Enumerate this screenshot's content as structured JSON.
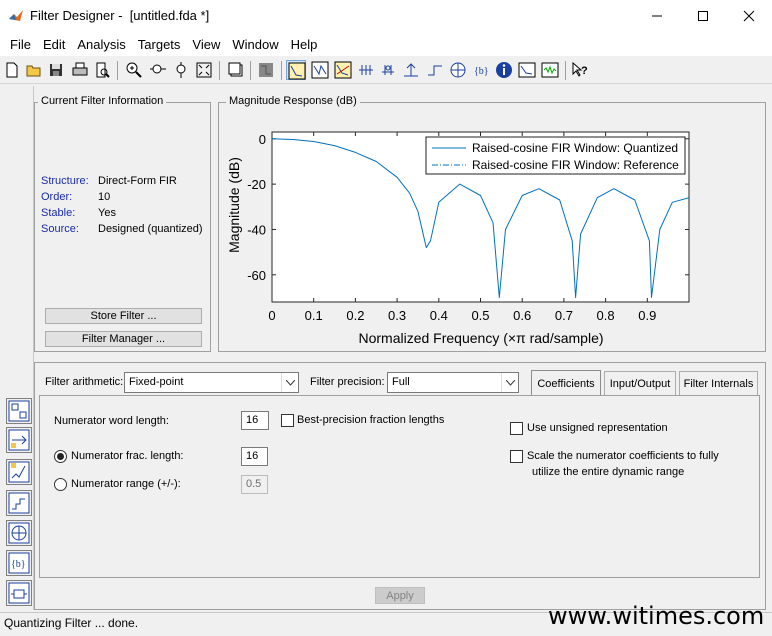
{
  "window": {
    "title": "Filter Designer -  [untitled.fda *]"
  },
  "menu": [
    "File",
    "Edit",
    "Analysis",
    "Targets",
    "View",
    "Window",
    "Help"
  ],
  "toolbar": {
    "icons": [
      "new-icon",
      "open-icon",
      "save-icon",
      "print-icon",
      "print-preview-icon",
      "zoom-in-icon",
      "zoom-x-icon",
      "zoom-y-icon",
      "full-view-icon",
      "new-figure-icon",
      "filter-specs-icon",
      "magnitude-response-icon",
      "phase-response-icon",
      "magnitude-phase-icon",
      "group-delay-icon",
      "phase-delay-icon",
      "impulse-response-icon",
      "step-response-icon",
      "pole-zero-icon",
      "filter-coefficients-icon",
      "filter-info-icon",
      "magnitude-estimate-icon",
      "round-off-noise-icon",
      "whats-this-icon"
    ]
  },
  "current_filter": {
    "title": "Current Filter Information",
    "rows": [
      {
        "label": "Structure:",
        "value": "Direct-Form FIR"
      },
      {
        "label": "Order:",
        "value": "10"
      },
      {
        "label": "Stable:",
        "value": "Yes"
      },
      {
        "label": "Source:",
        "value": "Designed (quantized)"
      }
    ],
    "store_button": "Store Filter ...",
    "manager_button": "Filter Manager ..."
  },
  "plot": {
    "title": "Magnitude Response (dB)",
    "chart_data": {
      "type": "line",
      "xlabel": "Normalized Frequency (×π rad/sample)",
      "ylabel": "Magnitude (dB)",
      "xlim": [
        0,
        1
      ],
      "ylim": [
        -72,
        3
      ],
      "xticks": [
        "0",
        "0.1",
        "0.2",
        "0.3",
        "0.4",
        "0.5",
        "0.6",
        "0.7",
        "0.8",
        "0.9"
      ],
      "yticks": [
        "0",
        "-20",
        "-40",
        "-60"
      ],
      "legend": [
        "Raised-cosine FIR Window: Quantized",
        "Raised-cosine FIR Window: Reference"
      ],
      "legend_position": "top-right",
      "series": [
        {
          "name": "Raised-cosine FIR Window: Quantized",
          "x": [
            0,
            0.05,
            0.1,
            0.15,
            0.2,
            0.25,
            0.3,
            0.33,
            0.35,
            0.37,
            0.38,
            0.4,
            0.45,
            0.5,
            0.53,
            0.545,
            0.56,
            0.6,
            0.64,
            0.69,
            0.72,
            0.728,
            0.74,
            0.78,
            0.82,
            0.87,
            0.905,
            0.91,
            0.93,
            0.96,
            1.0
          ],
          "y": [
            0,
            -0.3,
            -1.2,
            -3,
            -6,
            -10,
            -17,
            -24,
            -32,
            -48,
            -45,
            -28,
            -20,
            -25,
            -37,
            -70,
            -40,
            -25,
            -22,
            -27,
            -45,
            -70,
            -42,
            -26,
            -22,
            -27,
            -45,
            -70,
            -40,
            -28,
            -26
          ]
        }
      ]
    }
  },
  "tabs": [
    "Coefficients",
    "Input/Output",
    "Filter Internals"
  ],
  "quant": {
    "arith_label": "Filter arithmetic:",
    "arith_value": "Fixed-point",
    "precision_label": "Filter precision:",
    "precision_value": "Full",
    "num_word_label": "Numerator word length:",
    "num_word_value": "16",
    "best_precision_label": "Best-precision fraction lengths",
    "num_frac_label": "Numerator frac. length:",
    "num_frac_value": "16",
    "num_range_label": "Numerator range (+/-):",
    "num_range_value": "0.5",
    "unsigned_label": "Use unsigned representation",
    "scale_label_1": "Scale the numerator coefficients to fully",
    "scale_label_2": "utilize the entire dynamic range",
    "apply_button": "Apply"
  },
  "status": "Quantizing Filter ... done.",
  "watermark": "www.witimes.com"
}
